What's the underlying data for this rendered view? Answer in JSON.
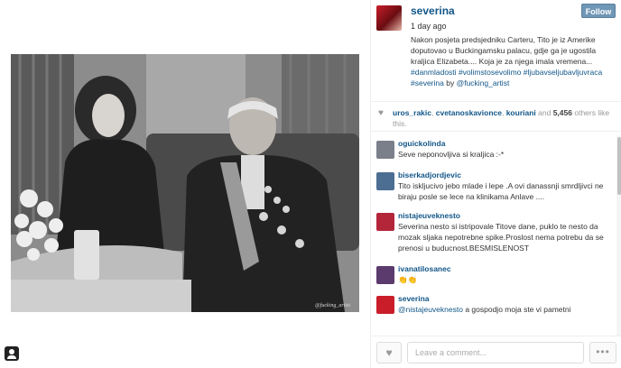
{
  "post": {
    "username": "severina",
    "follow_label": "Follow",
    "timestamp": "1 day ago",
    "caption_text": "Nakon posjeta predsjedniku Carteru, Tito je iz Amerike doputovao u Buckingamsku palacu, gdje ga je ugostila kraljica Elizabeta.... Koja je za njega imala vremena...",
    "caption_tags": [
      "#danmladosti",
      "#volimstosevolimo",
      "#ljubavseljubavljuvraca",
      "#severina"
    ],
    "caption_by": "by",
    "caption_mention": "@fucking_artist",
    "watermark": "@fucking_artist"
  },
  "likes": {
    "likers": [
      "uros_rakic",
      "cvetanoskavionce",
      "kouriani"
    ],
    "and_label": "and",
    "count": "5,456",
    "suffix": "others like this."
  },
  "comments": [
    {
      "user": "oguickolinda",
      "text": "Seve neponovljiva si kraljica :-*",
      "avatar_color": "#7a7f8a"
    },
    {
      "user": "biserkadjordjevic",
      "text": "Tito iskljucivo jebo mlade i lepe .A ovi danassnji smrdljivci ne biraju posle se lece na klinikama Anlave ....",
      "avatar_color": "#4c6e93"
    },
    {
      "user": "nistajeuveknesto",
      "text": "Severina nesto si istripovale Titove dane, puklo te nesto da mozak sljaka nepotrebne spike.Proslost nema potrebu da se prenosi u buducnost.BESMISLENOST",
      "avatar_color": "#b3263a"
    },
    {
      "user": "ivanatilosanec",
      "text": "👏👏",
      "avatar_color": "#5b3a6e"
    },
    {
      "user": "severina",
      "mention": "@nistajeuveknesto",
      "text": "a gospodjo moja ste vi pametni",
      "avatar_color": "#c91e2a"
    }
  ],
  "footer": {
    "comment_placeholder": "Leave a comment...",
    "more_label": "•••",
    "heart_glyph": "♥"
  },
  "colors": {
    "link": "#125688",
    "follow_button": "#6f97b6"
  }
}
